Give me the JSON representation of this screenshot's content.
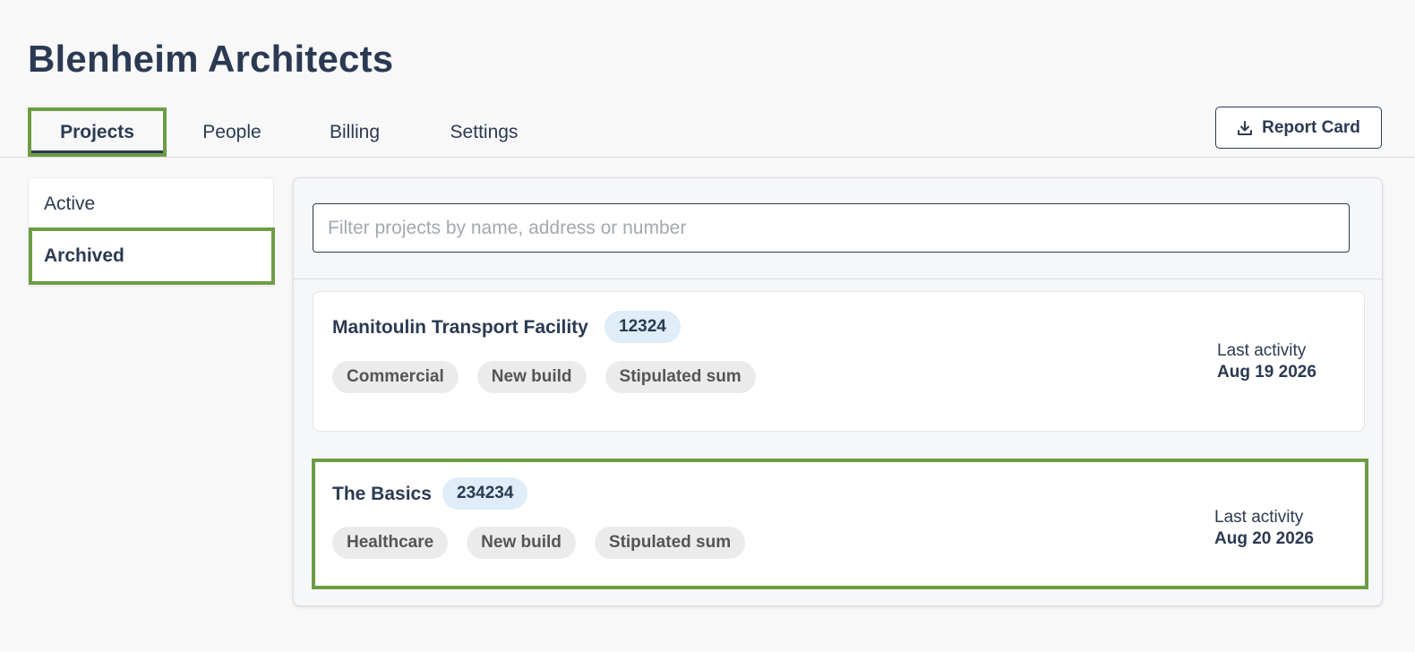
{
  "header": {
    "org_name": "Blenheim Architects",
    "tabs": [
      {
        "label": "Projects",
        "selected": true
      },
      {
        "label": "People",
        "selected": false
      },
      {
        "label": "Billing",
        "selected": false
      },
      {
        "label": "Settings",
        "selected": false
      }
    ],
    "report_button": {
      "label": "Report Card",
      "icon": "download-icon"
    }
  },
  "sidebar": {
    "items": [
      {
        "label": "Active",
        "selected": false
      },
      {
        "label": "Archived",
        "selected": true
      }
    ]
  },
  "main": {
    "search": {
      "placeholder": "Filter projects by name, address or number",
      "value": ""
    },
    "projects": [
      {
        "name": "Manitoulin Transport Facility",
        "number": "12324",
        "tags": [
          "Commercial",
          "New build",
          "Stipulated sum"
        ],
        "activity_label": "Last activity",
        "activity_date": "Aug 19 2026"
      },
      {
        "name": "The Basics",
        "number": "234234",
        "tags": [
          "Healthcare",
          "New build",
          "Stipulated sum"
        ],
        "activity_label": "Last activity",
        "activity_date": "Aug 20 2026"
      }
    ]
  },
  "colors": {
    "text": "#2b3a52",
    "highlight": "#6d9c45",
    "badge_bg": "#deedf8",
    "tag_bg": "#ebebeb",
    "page_bg": "#f8f8f9"
  }
}
